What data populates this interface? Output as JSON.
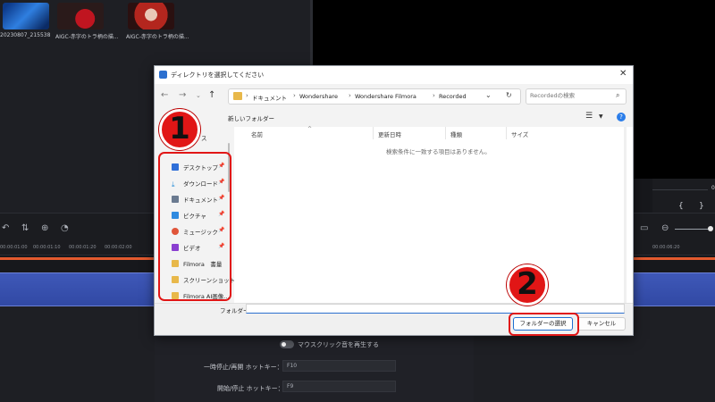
{
  "editor": {
    "media": [
      {
        "label": "20230807_215538"
      },
      {
        "label": "AIGC-赤字のトラ柄の描..."
      },
      {
        "label": "AIGC-赤字のトラ柄の描..."
      }
    ],
    "right_controls": {
      "brace_left": "{",
      "brace_right": "}",
      "counter": "00"
    },
    "ruler_ticks": [
      "00:00:01:00",
      "00:00:01:10",
      "00:00:01:20",
      "00:00:02:00",
      "00:00:06:20"
    ],
    "settings": {
      "mouse_click_sound": "マウスクリック音を再生する",
      "pause_hotkey_label": "一時停止/再開 ホットキー：",
      "pause_hotkey_value": "F10",
      "start_hotkey_label": "開始/停止 ホットキー：",
      "start_hotkey_value": "F9"
    }
  },
  "dialog": {
    "title": "ディレクトリを選択してください",
    "breadcrumbs": [
      "ドキュメント",
      "Wondershare",
      "Wondershare Filmora",
      "Recorded"
    ],
    "search_placeholder": "Recordedの検索",
    "new_folder": "新しいフォルダー",
    "nav_items": [
      {
        "label": "デスクトップ",
        "icon": "desktop-icon",
        "color": "#2f6fd8",
        "pinned": true
      },
      {
        "label": "ダウンロード",
        "icon": "download-icon",
        "color": "#2b8fd8",
        "pinned": true
      },
      {
        "label": "ドキュメント",
        "icon": "document-icon",
        "color": "#6a7a90",
        "pinned": true
      },
      {
        "label": "ピクチャ",
        "icon": "picture-icon",
        "color": "#2f8ae0",
        "pinned": true
      },
      {
        "label": "ミュージック",
        "icon": "music-icon",
        "color": "#e0553a",
        "pinned": true
      },
      {
        "label": "ビデオ",
        "icon": "video-icon",
        "color": "#8a3fd0",
        "pinned": true
      },
      {
        "label": "Filmora　書量",
        "icon": "folder-icon",
        "color": "#e8b84a",
        "pinned": false
      },
      {
        "label": "スクリーンショット",
        "icon": "folder-icon",
        "color": "#e8b84a",
        "pinned": false
      },
      {
        "label": "Filmora AI画像...",
        "icon": "folder-icon",
        "color": "#e8b84a",
        "pinned": false
      }
    ],
    "nav_header": "ス",
    "columns": [
      "名前",
      "更新日時",
      "種類",
      "サイズ"
    ],
    "empty_message": "検索条件に一致する項目はありません。",
    "folder_label": "フォルダー:",
    "folder_value": "",
    "select_button": "フォルダーの選択",
    "cancel_button": "キャンセル"
  },
  "annotations": {
    "step1": "1",
    "step2": "2",
    "highlight_color": "#e11616"
  }
}
